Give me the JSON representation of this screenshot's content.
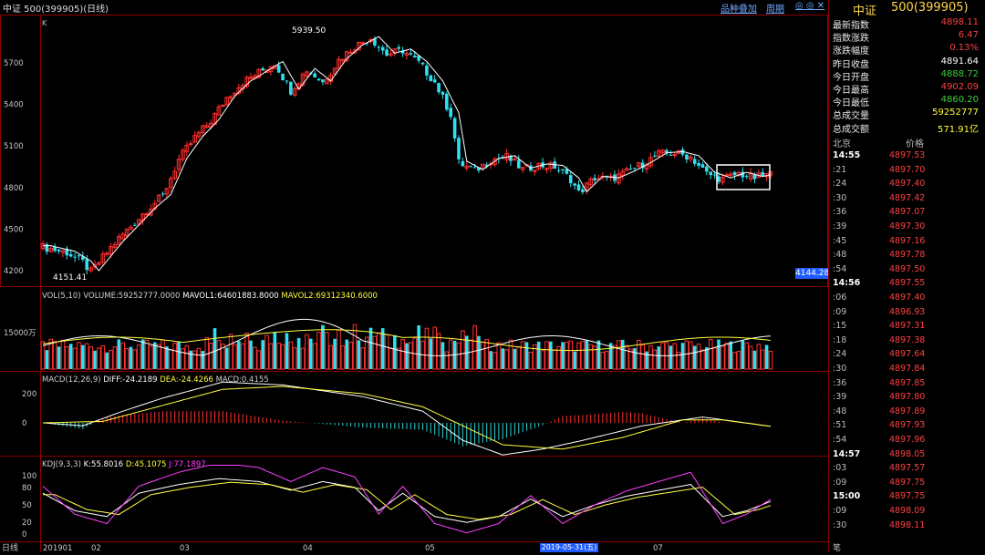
{
  "titlebar": {
    "title": "中证 500(399905)(日线)",
    "buttons": [
      "品种叠加",
      "周期",
      "◎ ◎ ✕"
    ]
  },
  "panels": {
    "price": {
      "k_label": "K",
      "high_label": "5939.50",
      "low_label": "4151.41",
      "current_tag": "4144.28",
      "y_ticks": [
        "5700",
        "5400",
        "5100",
        "4800",
        "4500",
        "4200"
      ]
    },
    "volume": {
      "legend": [
        {
          "text": "VOL(5,10) VOLUME:59252777.0000",
          "color": "#d0d0d0"
        },
        {
          "text": "MAVOL1:64601883.8000",
          "color": "#ffffff"
        },
        {
          "text": "MAVOL2:69312340.6000",
          "color": "#ffff40"
        }
      ],
      "y_tick": "15000万"
    },
    "macd": {
      "legend": [
        {
          "text": "MACD(12,26,9)",
          "color": "#d0d0d0"
        },
        {
          "text": "DIFF:-24.2189",
          "color": "#ffffff"
        },
        {
          "text": "DEA:-24.4266",
          "color": "#ffff40"
        },
        {
          "text": "MACD:0.4155",
          "color": "#d0d0d0"
        }
      ],
      "y_ticks": [
        "200",
        "0"
      ]
    },
    "kdj": {
      "legend": [
        {
          "text": "KDJ(9,3,3)",
          "color": "#d0d0d0"
        },
        {
          "text": "K:55.8016",
          "color": "#ffffff"
        },
        {
          "text": "D:45.1075",
          "color": "#ffff40"
        },
        {
          "text": "J:77.1897",
          "color": "#ff40ff"
        }
      ],
      "y_ticks": [
        "100",
        "80",
        "50",
        "20",
        "0"
      ]
    }
  },
  "xaxis": {
    "label": "日线",
    "ticks": [
      "201901",
      "02",
      "03",
      "04",
      "05",
      "07"
    ],
    "selected_date": "2019-05-31(五)"
  },
  "sidebar": {
    "title_a": "中证",
    "title_b": "500(399905)",
    "quotes": [
      {
        "label": "最新指数",
        "value": "4898.11",
        "color": "#ff4040"
      },
      {
        "label": "指数涨跌",
        "value": "6.47",
        "color": "#ff4040"
      },
      {
        "label": "涨跌幅度",
        "value": "0.13%",
        "color": "#ff4040"
      },
      {
        "label": "昨日收盘",
        "value": "4891.64",
        "color": "#ffffff"
      },
      {
        "label": "今日开盘",
        "value": "4888.72",
        "color": "#3ecf3e"
      },
      {
        "label": "今日最高",
        "value": "4902.09",
        "color": "#ff4040"
      },
      {
        "label": "今日最低",
        "value": "4860.20",
        "color": "#3ecf3e"
      },
      {
        "label": "总成交量",
        "value": "59252777",
        "color": "#ffff40"
      },
      {
        "label": "总成交额",
        "value": "571.91亿",
        "color": "#ffff40"
      }
    ],
    "ticks_header": {
      "left": "北京",
      "right": "价格"
    },
    "ticks": [
      {
        "t": "14:55",
        "p": "4897.53",
        "bold": true
      },
      {
        "t": ":21",
        "p": "4897.70"
      },
      {
        "t": ":24",
        "p": "4897.40"
      },
      {
        "t": ":30",
        "p": "4897.42"
      },
      {
        "t": ":36",
        "p": "4897.07"
      },
      {
        "t": ":39",
        "p": "4897.30"
      },
      {
        "t": ":45",
        "p": "4897.16"
      },
      {
        "t": ":48",
        "p": "4897.78"
      },
      {
        "t": ":54",
        "p": "4897.50"
      },
      {
        "t": "14:56",
        "p": "4897.55",
        "bold": true
      },
      {
        "t": ":06",
        "p": "4897.40"
      },
      {
        "t": ":09",
        "p": "4896.93"
      },
      {
        "t": ":15",
        "p": "4897.31"
      },
      {
        "t": ":18",
        "p": "4897.38"
      },
      {
        "t": ":24",
        "p": "4897.64"
      },
      {
        "t": ":30",
        "p": "4897.84"
      },
      {
        "t": ":36",
        "p": "4897.85"
      },
      {
        "t": ":39",
        "p": "4897.80"
      },
      {
        "t": ":48",
        "p": "4897.89"
      },
      {
        "t": ":51",
        "p": "4897.93"
      },
      {
        "t": ":54",
        "p": "4897.96"
      },
      {
        "t": "14:57",
        "p": "4898.05",
        "bold": true
      },
      {
        "t": ":03",
        "p": "4897.57"
      },
      {
        "t": ":09",
        "p": "4897.75"
      },
      {
        "t": "15:00",
        "p": "4897.75",
        "bold": true
      },
      {
        "t": ":09",
        "p": "4898.09"
      },
      {
        "t": ":30",
        "p": "4898.11"
      }
    ],
    "bottom_label": "笔"
  },
  "chart_data": {
    "type": "candlestick",
    "series": [
      {
        "name": "price",
        "anchors": [
          [
            0,
            4370
          ],
          [
            6,
            4330
          ],
          [
            10,
            4260
          ],
          [
            12,
            4190
          ],
          [
            14,
            4260
          ],
          [
            18,
            4400
          ],
          [
            22,
            4520
          ],
          [
            26,
            4640
          ],
          [
            30,
            4740
          ],
          [
            34,
            5000
          ],
          [
            38,
            5160
          ],
          [
            42,
            5280
          ],
          [
            46,
            5450
          ],
          [
            50,
            5560
          ],
          [
            54,
            5630
          ],
          [
            58,
            5700
          ],
          [
            62,
            5500
          ],
          [
            66,
            5650
          ],
          [
            70,
            5560
          ],
          [
            74,
            5720
          ],
          [
            78,
            5820
          ],
          [
            82,
            5880
          ],
          [
            86,
            5760
          ],
          [
            90,
            5790
          ],
          [
            94,
            5700
          ],
          [
            98,
            5560
          ],
          [
            102,
            5330
          ],
          [
            104,
            4980
          ],
          [
            108,
            4920
          ],
          [
            112,
            5000
          ],
          [
            116,
            5020
          ],
          [
            120,
            4930
          ],
          [
            124,
            4960
          ],
          [
            128,
            4950
          ],
          [
            132,
            4860
          ],
          [
            134,
            4760
          ],
          [
            138,
            4870
          ],
          [
            142,
            4860
          ],
          [
            146,
            4910
          ],
          [
            150,
            4970
          ],
          [
            154,
            5040
          ],
          [
            158,
            5050
          ],
          [
            162,
            5020
          ],
          [
            166,
            4900
          ],
          [
            170,
            4860
          ],
          [
            174,
            4900
          ],
          [
            178,
            4870
          ],
          [
            182,
            4895
          ]
        ]
      },
      {
        "name": "volume",
        "range": [
          0.35,
          1.0
        ]
      },
      {
        "name": "macd_diff",
        "anchors": [
          [
            0,
            0
          ],
          [
            10,
            -20
          ],
          [
            20,
            80
          ],
          [
            30,
            170
          ],
          [
            45,
            280
          ],
          [
            60,
            260
          ],
          [
            80,
            180
          ],
          [
            95,
            80
          ],
          [
            105,
            -120
          ],
          [
            115,
            -220
          ],
          [
            125,
            -180
          ],
          [
            135,
            -120
          ],
          [
            150,
            -20
          ],
          [
            165,
            40
          ],
          [
            182,
            -24
          ]
        ]
      },
      {
        "name": "macd_dea",
        "anchors": [
          [
            0,
            0
          ],
          [
            15,
            10
          ],
          [
            30,
            120
          ],
          [
            45,
            230
          ],
          [
            60,
            250
          ],
          [
            80,
            200
          ],
          [
            95,
            110
          ],
          [
            105,
            -20
          ],
          [
            115,
            -150
          ],
          [
            130,
            -180
          ],
          [
            145,
            -100
          ],
          [
            160,
            20
          ],
          [
            170,
            20
          ],
          [
            182,
            -24
          ]
        ]
      },
      {
        "name": "kdj_k",
        "anchors": [
          [
            0,
            70
          ],
          [
            8,
            40
          ],
          [
            16,
            30
          ],
          [
            24,
            70
          ],
          [
            34,
            85
          ],
          [
            44,
            95
          ],
          [
            54,
            90
          ],
          [
            62,
            75
          ],
          [
            70,
            90
          ],
          [
            78,
            80
          ],
          [
            84,
            40
          ],
          [
            90,
            70
          ],
          [
            98,
            30
          ],
          [
            106,
            20
          ],
          [
            114,
            30
          ],
          [
            122,
            60
          ],
          [
            130,
            30
          ],
          [
            138,
            50
          ],
          [
            146,
            65
          ],
          [
            154,
            75
          ],
          [
            162,
            85
          ],
          [
            170,
            30
          ],
          [
            176,
            40
          ],
          [
            182,
            56
          ]
        ]
      }
    ]
  }
}
